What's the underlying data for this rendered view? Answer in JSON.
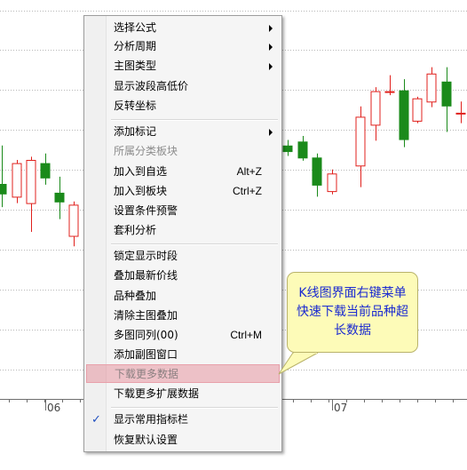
{
  "chart": {
    "x_axis_labels": [
      "06",
      "07"
    ],
    "up_color": "#e0201c",
    "down_color": "#1a8a1a",
    "candles": [
      {
        "o": 182.0,
        "h": 186.8,
        "l": 179.1,
        "c": 180.8
      },
      {
        "o": 180.4,
        "h": 185.0,
        "l": 179.6,
        "c": 184.6
      },
      {
        "o": 179.6,
        "h": 185.4,
        "l": 176.0,
        "c": 185.0
      },
      {
        "o": 184.6,
        "h": 185.8,
        "l": 181.9,
        "c": 182.8
      },
      {
        "o": 180.9,
        "h": 182.9,
        "l": 177.6,
        "c": 179.8
      },
      {
        "o": 175.5,
        "h": 179.8,
        "l": 174.2,
        "c": 179.4
      },
      {
        "o": 186.8,
        "h": 187.5,
        "l": 185.5,
        "c": 186.1
      },
      {
        "o": 187.3,
        "h": 188.0,
        "l": 184.9,
        "c": 185.3
      },
      {
        "o": 185.3,
        "h": 185.8,
        "l": 180.4,
        "c": 181.9
      },
      {
        "o": 181.1,
        "h": 183.8,
        "l": 180.7,
        "c": 183.3
      },
      {
        "o": 184.3,
        "h": 191.7,
        "l": 181.6,
        "c": 190.4
      },
      {
        "o": 189.4,
        "h": 194.1,
        "l": 187.4,
        "c": 193.6
      },
      {
        "o": 193.6,
        "h": 195.6,
        "l": 193.1,
        "c": 193.6
      },
      {
        "o": 193.7,
        "h": 195.1,
        "l": 186.6,
        "c": 187.6
      },
      {
        "o": 189.9,
        "h": 192.9,
        "l": 189.6,
        "c": 192.7
      },
      {
        "o": 192.3,
        "h": 196.6,
        "l": 191.6,
        "c": 195.8
      },
      {
        "o": 194.8,
        "h": 196.6,
        "l": 188.5,
        "c": 191.8
      },
      {
        "o": 190.9,
        "h": 192.3,
        "l": 189.6,
        "c": 190.9
      }
    ]
  },
  "menu": {
    "items": [
      {
        "label": "选择公式",
        "submenu": true
      },
      {
        "label": "分析周期",
        "submenu": true
      },
      {
        "label": "主图类型",
        "submenu": true
      },
      {
        "label": "显示波段高低价"
      },
      {
        "label": "反转坐标"
      },
      {
        "label": "添加标记",
        "submenu": true
      },
      {
        "label": "所属分类板块",
        "disabled": true
      },
      {
        "label": "加入到自选",
        "shortcut": "Alt+Z"
      },
      {
        "label": "加入到板块",
        "shortcut": "Ctrl+Z"
      },
      {
        "label": "设置条件预警"
      },
      {
        "label": "套利分析"
      },
      {
        "label": "锁定显示时段"
      },
      {
        "label": "叠加最新价线"
      },
      {
        "label": "品种叠加"
      },
      {
        "label": "清除主图叠加"
      },
      {
        "label": "多图同列(00)",
        "shortcut": "Ctrl+M"
      },
      {
        "label": "添加副图窗口"
      },
      {
        "label": "下载更多数据",
        "highlighted": true
      },
      {
        "label": "下载更多扩展数据"
      },
      {
        "label": "显示常用指标栏",
        "checked": true
      },
      {
        "label": "恢复默认设置"
      }
    ]
  },
  "callout": {
    "text": "K线图界面右键菜单快速下载当前品种超长数据"
  }
}
